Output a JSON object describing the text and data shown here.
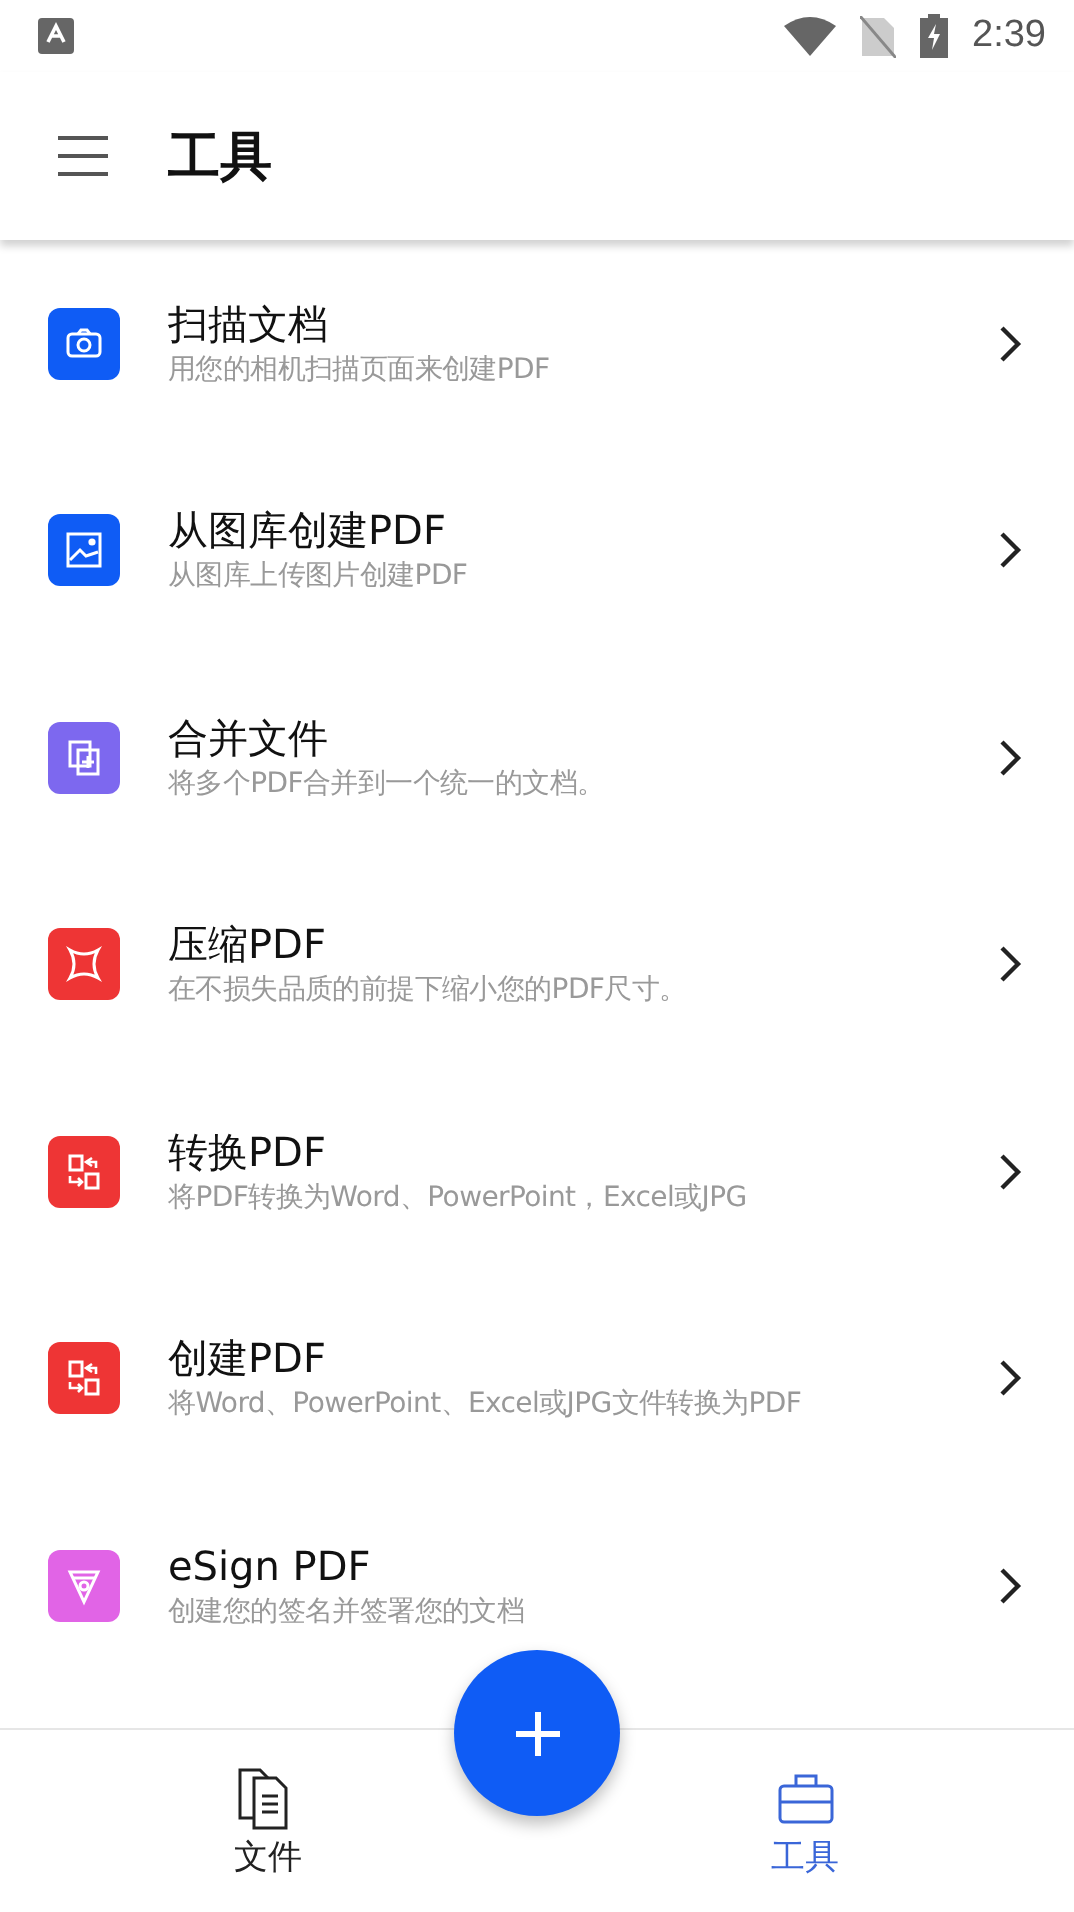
{
  "status_bar": {
    "time": "2:39"
  },
  "app_bar": {
    "title": "工具"
  },
  "tools": [
    {
      "kind": "scan",
      "color": "#0f5cf5",
      "title": "扫描文档",
      "subtitle": "用您的相机扫描页面来创建PDF"
    },
    {
      "kind": "gallery",
      "color": "#0f5cf5",
      "title": "从图库创建PDF",
      "subtitle": "从图库上传图片创建PDF"
    },
    {
      "kind": "merge",
      "color": "#7d68ef",
      "title": "合并文件",
      "subtitle": "将多个PDF合并到一个统一的文档。"
    },
    {
      "kind": "compress",
      "color": "#ee3535",
      "title": "压缩PDF",
      "subtitle": "在不损失品质的前提下缩小您的PDF尺寸。"
    },
    {
      "kind": "convert",
      "color": "#ee3535",
      "title": "转换PDF",
      "subtitle": "将PDF转换为Word、PowerPoint，Excel或JPG"
    },
    {
      "kind": "convert",
      "color": "#ee3535",
      "title": "创建PDF",
      "subtitle": "将Word、PowerPoint、Excel或JPG文件转换为PDF"
    },
    {
      "kind": "sign",
      "color": "#e164e6",
      "title": "eSign PDF",
      "subtitle": "创建您的签名并签署您的文档"
    }
  ],
  "bottom_nav": [
    {
      "kind": "files",
      "label": "文件",
      "selected": false
    },
    {
      "kind": "tools",
      "label": "工具",
      "selected": true
    }
  ]
}
